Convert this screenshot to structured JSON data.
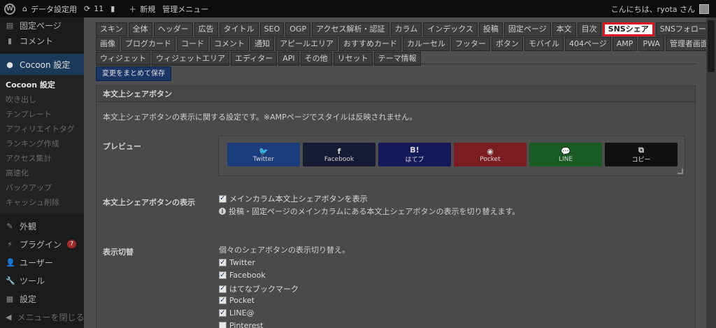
{
  "adminbar": {
    "site_name": "データ設定用",
    "updates_count": "11",
    "new_label": "新規",
    "admin_menu_label": "管理メニュー",
    "greeting": "こんにちは、ryota さん"
  },
  "sidebar": {
    "items_top": [
      {
        "label": "固定ページ",
        "icon": "page-icon"
      },
      {
        "label": "コメント",
        "icon": "comment-icon"
      }
    ],
    "active": {
      "label": "Cocoon 設定",
      "icon": "cocoon-icon"
    },
    "submenu": [
      {
        "label": "Cocoon 設定",
        "current": true
      },
      {
        "label": "吹き出し"
      },
      {
        "label": "テンプレート"
      },
      {
        "label": "アフィリエイトタグ"
      },
      {
        "label": "ランキング作成"
      },
      {
        "label": "アクセス集計"
      },
      {
        "label": "高速化"
      },
      {
        "label": "バックアップ"
      },
      {
        "label": "キャッシュ削除"
      }
    ],
    "items_bottom": [
      {
        "label": "外観",
        "icon": "brush-icon"
      },
      {
        "label": "プラグイン",
        "icon": "plugin-icon",
        "badge": "7"
      },
      {
        "label": "ユーザー",
        "icon": "user-icon"
      },
      {
        "label": "ツール",
        "icon": "wrench-icon"
      },
      {
        "label": "設定",
        "icon": "settings-icon"
      },
      {
        "label": "メニューを閉じる",
        "icon": "collapse-icon"
      }
    ]
  },
  "tabs": {
    "row1": [
      "スキン",
      "全体",
      "ヘッダー",
      "広告",
      "タイトル",
      "SEO",
      "OGP",
      "アクセス解析・認証",
      "カラム",
      "インデックス",
      "投稿",
      "固定ページ",
      "本文",
      "目次",
      "SNSシェア",
      "SNSフォロー"
    ],
    "row2": [
      "画像",
      "ブログカード",
      "コード",
      "コメント",
      "通知",
      "アピールエリア",
      "おすすめカード",
      "カルーセル",
      "フッター",
      "ボタン",
      "モバイル",
      "404ページ",
      "AMP",
      "PWA",
      "管理者画面"
    ],
    "row3": [
      "ウィジェット",
      "ウィジェットエリア",
      "エディター",
      "API",
      "その他",
      "リセット",
      "テーマ情報"
    ],
    "selected": "SNSシェア"
  },
  "save_button": "変更をまとめて保存",
  "panel": {
    "title": "本文上シェアボタン",
    "description": "本文上シェアボタンの表示に関する設定です。※AMPページでスタイルは反映されません。",
    "preview_label": "プレビュー",
    "share_buttons": [
      {
        "icon_text": "🐦",
        "label": "Twitter",
        "color": "#1b3d7c"
      },
      {
        "icon_text": "f",
        "label": "Facebook",
        "color": "#161b33"
      },
      {
        "icon_text": "B!",
        "label": "はてブ",
        "color": "#14195a"
      },
      {
        "icon_text": "◉",
        "label": "Pocket",
        "color": "#7a1c22"
      },
      {
        "icon_text": "💬",
        "label": "LINE",
        "color": "#1a5a24"
      },
      {
        "icon_text": "⧉",
        "label": "コピー",
        "color": "#101010"
      }
    ],
    "display_label": "本文上シェアボタンの表示",
    "display_checkbox": "メインカラム本文上シェアボタンを表示",
    "display_info": "投稿・固定ページのメインカラムにある本文上シェアボタンの表示を切り替えます。",
    "toggle_label": "表示切替",
    "toggle_desc": "個々のシェアボタンの表示切り替え。",
    "toggle_items": [
      {
        "label": "Twitter",
        "checked": true
      },
      {
        "label": "Facebook",
        "checked": true
      },
      {
        "label": "はてなブックマーク",
        "checked": true
      },
      {
        "label": "Pocket",
        "checked": true
      },
      {
        "label": "LINE@",
        "checked": true
      },
      {
        "label": "Pinterest",
        "checked": false
      }
    ]
  }
}
